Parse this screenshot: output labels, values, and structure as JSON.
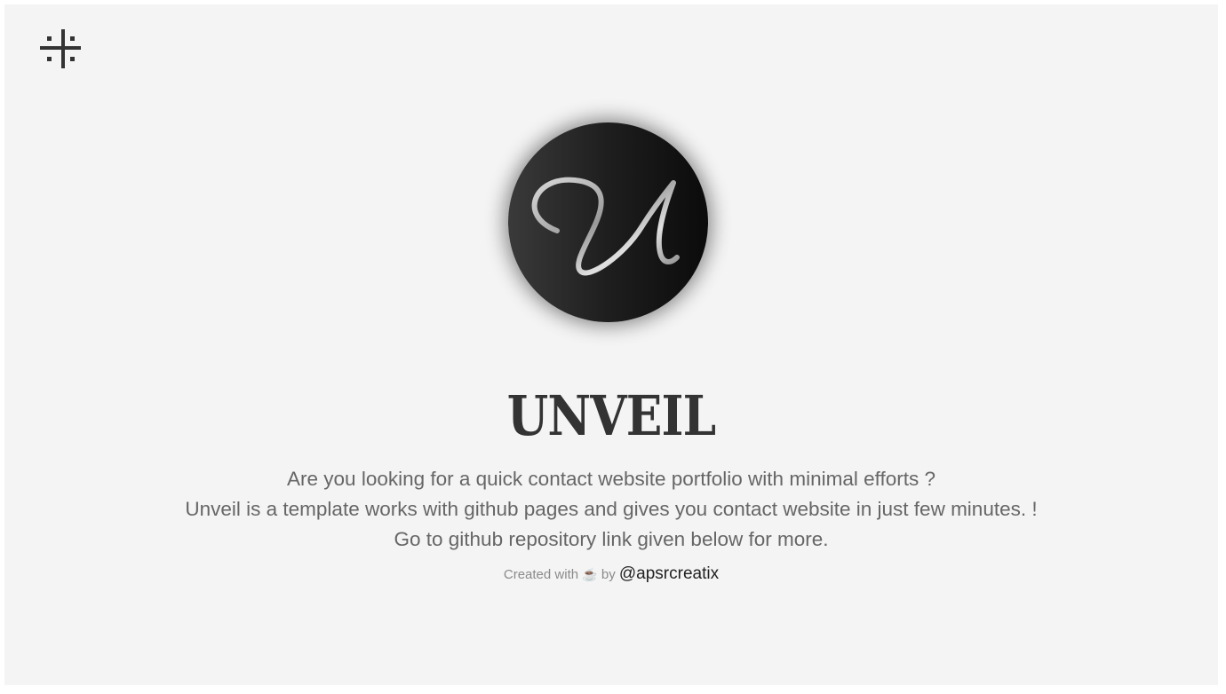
{
  "header": {
    "menu_icon": "hash-grid-icon"
  },
  "profile": {
    "avatar_letter": "U",
    "title": "UNVEIL"
  },
  "description": {
    "line1": "Are you looking for a quick contact website portfolio with minimal efforts ?",
    "line2": "Unveil is a template works with github pages and gives you contact website in just few minutes. !",
    "line3": "Go to github repository link given below for more."
  },
  "footer": {
    "created_with": "Created with",
    "cup_icon": "coffee-icon",
    "cup_glyph": "☕",
    "by": "by",
    "author_link": "@apsrcreatix"
  },
  "colors": {
    "background": "#f4f4f4",
    "title": "#333333",
    "body_text": "#666666",
    "link": "#222222"
  }
}
